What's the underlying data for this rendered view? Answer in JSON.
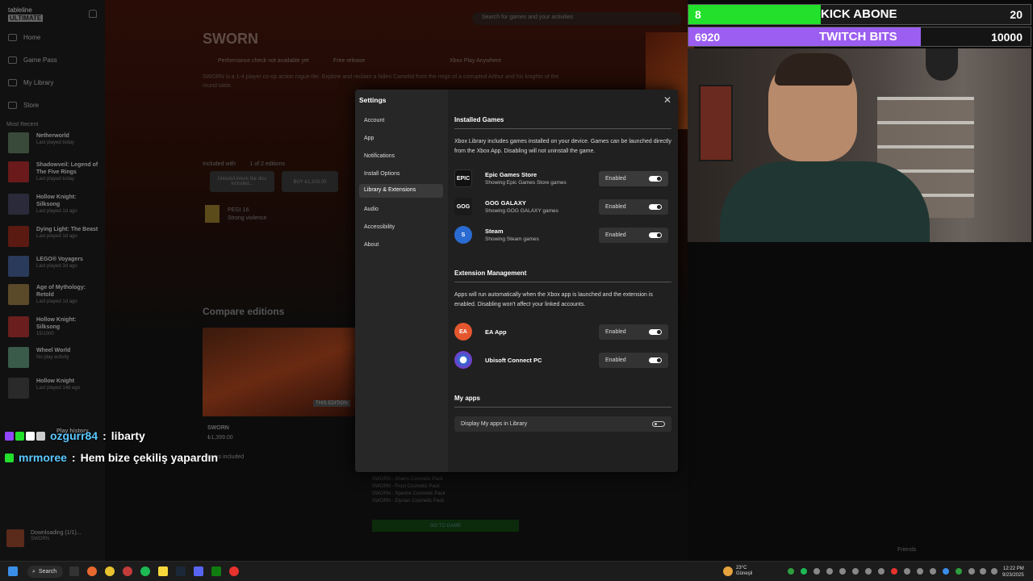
{
  "sidebar": {
    "brand_line1": "tableline",
    "brand_line2": "ULTIMATE",
    "nav": [
      "Home",
      "Game Pass",
      "My Library",
      "Store"
    ],
    "recent_label": "Most Recent",
    "games": [
      {
        "name": "Netherworld",
        "sub": "Last played today",
        "color": "#3a4a3a"
      },
      {
        "name": "Shadowveil: Legend of The Five Rings",
        "sub": "Last played today",
        "color": "#6a1a1a"
      },
      {
        "name": "Hollow Knight: Silksong",
        "sub": "Last played 1d ago",
        "color": "#2a2a3a"
      },
      {
        "name": "Dying Light: The Beast",
        "sub": "Last played 1d ago",
        "color": "#5a1a12"
      },
      {
        "name": "LEGO® Voyagers",
        "sub": "Last played 3d ago",
        "color": "#2a3a5a"
      },
      {
        "name": "Age of Mythology: Retold",
        "sub": "Last played 1d ago",
        "color": "#5a4a2a"
      },
      {
        "name": "Hollow Knight: Silksong",
        "sub": "15/1000",
        "color": "#6a1e1e"
      },
      {
        "name": "Wheel World",
        "sub": "No play activity",
        "color": "#3a5a4a"
      },
      {
        "name": "Hollow Knight",
        "sub": "Last played 14d ago",
        "color": "#2a2a2a"
      }
    ],
    "play_history": "Play history",
    "downloading_title": "Downloading (1/1)...",
    "downloading_game": "SWORN"
  },
  "main": {
    "search_placeholder": "Search for games and your activities",
    "title": "SWORN",
    "info": [
      "Performance check not available yet",
      "Free release",
      "Xbox Play Anywhere"
    ],
    "description": "SWORN is a 1-4 player co-op action rogue-lite. Explore and reclaim a fallen Camelot from the reign of a corrupted Arthur and his knights of the round table.",
    "included": "Included with",
    "editions": "1 of 2 editions",
    "btn1": "Unlock/Unlock the dlcs included...",
    "btn2": "BUY ₺1,103.00",
    "pegi": "PEGI 16",
    "pegi_sub": "Strong violence",
    "compare": "Compare editions",
    "edition_tag": "THIS EDITION",
    "edition_name": "SWORN",
    "edition_price": "₺1,399.00",
    "edition_items": "Items included",
    "dlc_list": [
      "SWORN - Sharm Cosmetic Pack",
      "SWORN - Frost Cosmetic Pack",
      "SWORN - Spectre Cosmetic Pack",
      "SWORN - Elysian Cosmetic Pack"
    ],
    "goto": "GO TO GAME",
    "friends": "Friends"
  },
  "chat": [
    {
      "user": "ozgurr84",
      "sep": " : ",
      "msg": "libarty",
      "badges": [
        "#9146ff",
        "#22e02b",
        "#ffffff",
        "#dddddd"
      ]
    },
    {
      "user": "mrmoree",
      "sep": " : ",
      "msg": "Hem bize çekiliş yapardın",
      "badges": [
        "#22e02b"
      ]
    }
  ],
  "settings": {
    "title": "Settings",
    "nav": [
      "Account",
      "App",
      "Notifications",
      "Install Options",
      "Library & Extensions",
      "Audio",
      "Accessibility",
      "About"
    ],
    "active": "Library & Extensions",
    "installed": {
      "heading": "Installed Games",
      "desc": "Xbox Library includes games installed on your device. Games can be launched directly from the Xbox App. Disabling will not uninstall the game.",
      "items": [
        {
          "name": "Epic Games Store",
          "sub": "Showing Epic Games Store games",
          "state": "Enabled",
          "logo": "EPIC",
          "color": "#111111"
        },
        {
          "name": "GOG GALAXY",
          "sub": "Showing GOG GALAXY games",
          "state": "Enabled",
          "logo": "GOG",
          "color": "#1a1a1a"
        },
        {
          "name": "Steam",
          "sub": "Showing Steam games",
          "state": "Enabled",
          "logo": "S",
          "color": "#1b2838"
        }
      ]
    },
    "extensions": {
      "heading": "Extension Management",
      "desc": "Apps will run automatically when the Xbox app is launched and the extension is enabled. Disabling won't affect your linked accounts.",
      "items": [
        {
          "name": "EA App",
          "state": "Enabled",
          "logo": "EA",
          "color": "#e4572e"
        },
        {
          "name": "Ubisoft Connect PC",
          "state": "Enabled",
          "logo": "U",
          "color": "#2a6bd1"
        }
      ]
    },
    "myapps": {
      "heading": "My apps",
      "row": "Display My apps in Library"
    }
  },
  "overlay": {
    "kick": {
      "value": "8",
      "label": "KICK ABONE",
      "goal": "20",
      "color": "#22e02b"
    },
    "twitch": {
      "value": "6920",
      "label": "TWITCH BITS",
      "goal": "10000",
      "color": "#9b5ef0"
    }
  },
  "taskbar": {
    "search": "Search",
    "temp": "23°C",
    "weather": "Güneşli",
    "time": "12:22 PM",
    "date": "9/23/2025"
  }
}
